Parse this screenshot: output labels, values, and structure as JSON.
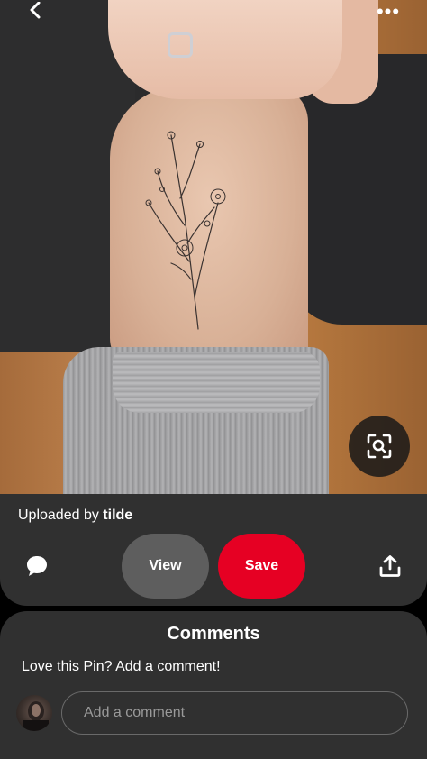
{
  "header": {
    "back_icon": "chevron-left-icon",
    "more_label": "•••"
  },
  "photo": {
    "lens_icon": "visual-search-icon"
  },
  "pin": {
    "uploaded_prefix": "Uploaded by",
    "uploader": "tilde",
    "comment_icon": "speech-bubble-icon",
    "view_label": "View",
    "save_label": "Save",
    "share_icon": "share-icon",
    "save_color": "#e60023"
  },
  "comments": {
    "title": "Comments",
    "prompt": "Love this Pin? Add a comment!",
    "input_placeholder": "Add a comment"
  }
}
